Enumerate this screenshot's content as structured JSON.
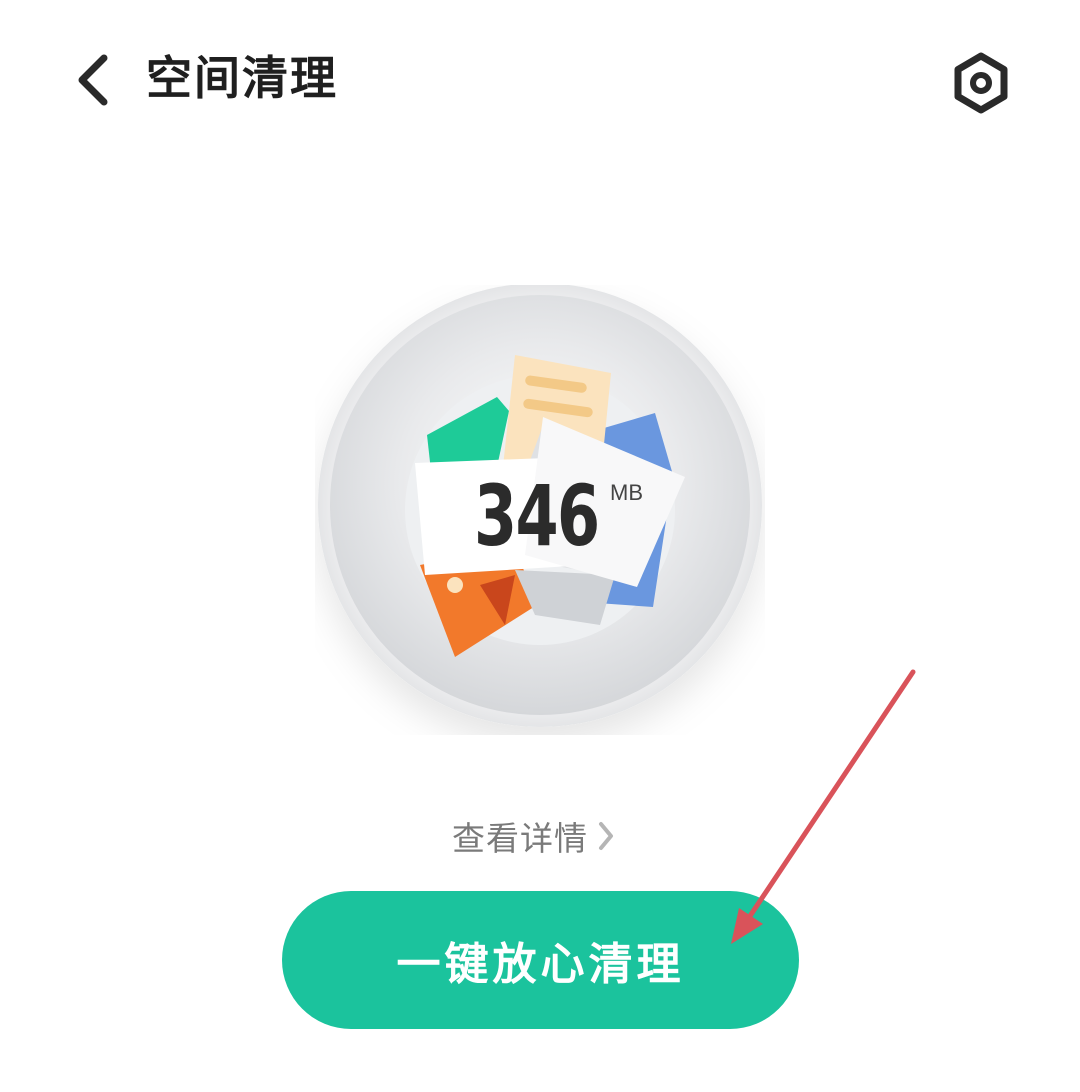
{
  "header": {
    "title": "空间清理",
    "back_icon": "chevron-left-icon",
    "settings_icon": "settings-hexagon-icon"
  },
  "scan": {
    "size_value": "346",
    "size_unit": "MB"
  },
  "details": {
    "label": "查看详情",
    "icon": "chevron-right-icon"
  },
  "action": {
    "clean_label": "一键放心清理"
  },
  "colors": {
    "accent": "#1bc39d",
    "annotation": "#d9535a"
  }
}
